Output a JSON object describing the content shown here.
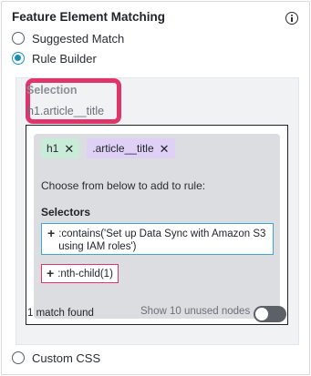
{
  "header": {
    "title": "Feature Element Matching",
    "info_icon": "info-icon"
  },
  "options": [
    {
      "label": "Suggested Match",
      "selected": false
    },
    {
      "label": "Rule Builder",
      "selected": true
    },
    {
      "label": "Custom CSS",
      "selected": false
    }
  ],
  "selection": {
    "label": "Selection",
    "value": "h1.article__title"
  },
  "rule": {
    "chips": [
      {
        "label": "h1",
        "color": "#c8ecd7"
      },
      {
        "label": ".article__title",
        "color": "#dfd0f5"
      }
    ],
    "chip_remove_symbol": "✕",
    "choose_text": "Choose from below to add to rule:",
    "selectors_label": "Selectors",
    "add_symbol": "+",
    "selectors": [
      {
        "label": ":contains('Set up Data Sync with Amazon S3 using IAM roles')"
      },
      {
        "label": ":nth-child(1)"
      }
    ]
  },
  "footer": {
    "match_count": "1 match found",
    "unused_label": "Show 10 unused nodes",
    "unused_toggle_on": false
  },
  "colors": {
    "accent": "#1a8fb6",
    "highlight": "#e0356b",
    "selector_border": "#3fa8d1"
  }
}
